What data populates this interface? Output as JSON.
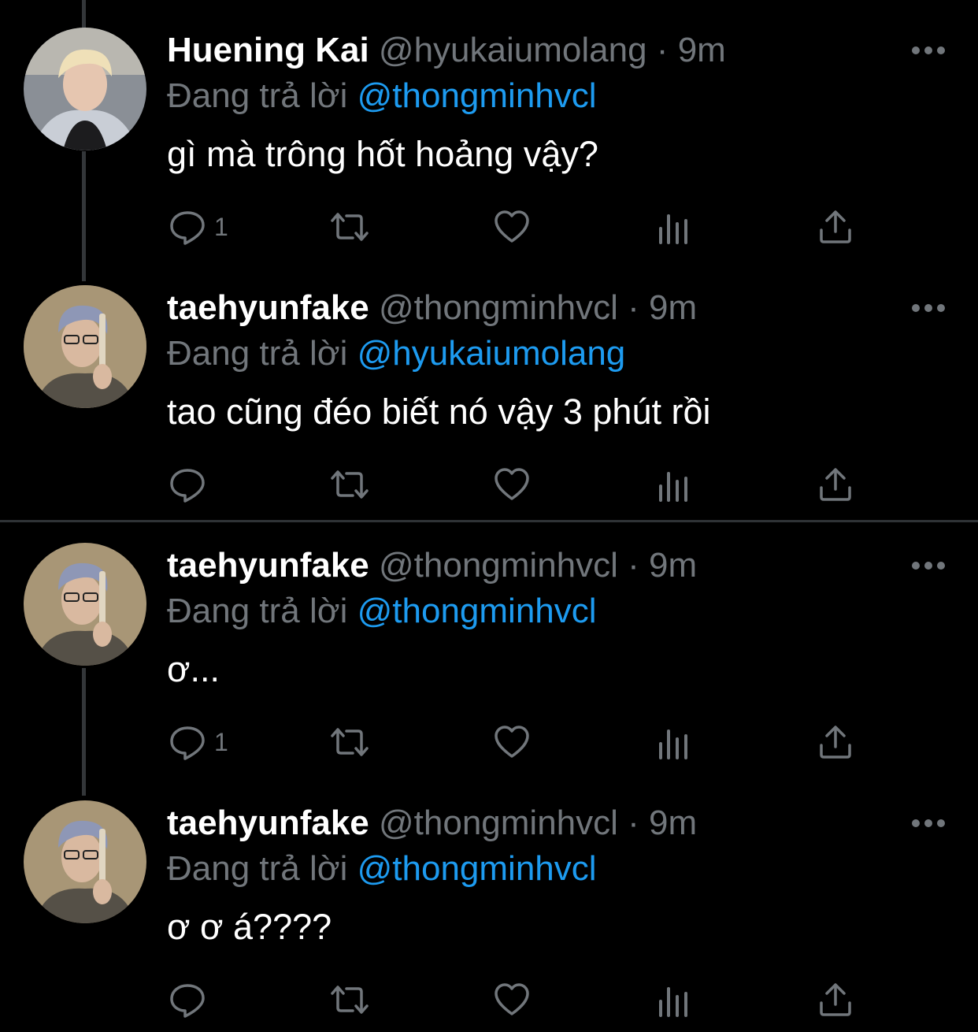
{
  "reply_prefix": "Đang trả lời",
  "tweets": [
    {
      "display_name": "Huening Kai",
      "handle": "@hyukaiumolang",
      "dot": "·",
      "time": "9m",
      "reply_to": "@thongminhvcl",
      "text": "gì mà trông hốt hoảng vậy?",
      "reply_count": "1"
    },
    {
      "display_name": "taehyunfake",
      "handle": "@thongminhvcl",
      "dot": "·",
      "time": "9m",
      "reply_to": "@hyukaiumolang",
      "text": "tao cũng đéo biết nó vậy 3 phút rồi",
      "reply_count": ""
    },
    {
      "display_name": "taehyunfake",
      "handle": "@thongminhvcl",
      "dot": "·",
      "time": "9m",
      "reply_to": "@thongminhvcl",
      "text": "ơ...",
      "reply_count": "1"
    },
    {
      "display_name": "taehyunfake",
      "handle": "@thongminhvcl",
      "dot": "·",
      "time": "9m",
      "reply_to": "@thongminhvcl",
      "text": "ơ ơ á????",
      "reply_count": ""
    }
  ],
  "icons": {
    "reply": "reply-icon",
    "retweet": "retweet-icon",
    "like": "like-icon",
    "analytics": "analytics-icon",
    "share": "share-icon",
    "more": "more-icon"
  },
  "colors": {
    "background": "#000000",
    "text": "#ffffff",
    "muted": "#71767b",
    "link": "#1d9bf0",
    "divider": "#2f3336"
  }
}
